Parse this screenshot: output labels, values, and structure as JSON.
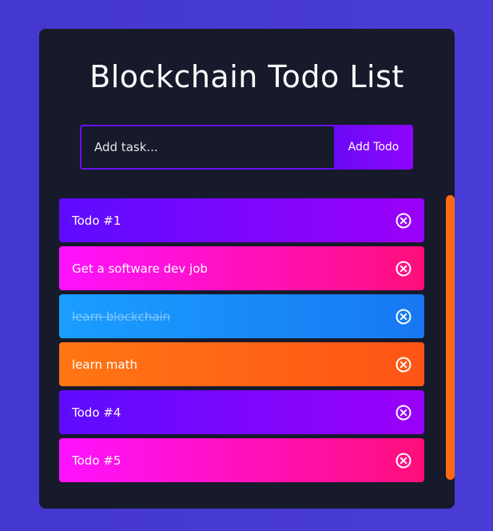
{
  "app": {
    "title": "Blockchain Todo List"
  },
  "form": {
    "input_placeholder": "Add task...",
    "input_value": "",
    "add_button_label": "Add Todo"
  },
  "todos": [
    {
      "text": "Todo #1",
      "color": "purple",
      "complete": false
    },
    {
      "text": "Get a software dev job",
      "color": "pink",
      "complete": false
    },
    {
      "text": "learn blockchain",
      "color": "blue",
      "complete": true
    },
    {
      "text": "learn math",
      "color": "orange",
      "complete": false
    },
    {
      "text": "Todo #4",
      "color": "purple",
      "complete": false
    },
    {
      "text": "Todo #5",
      "color": "pink",
      "complete": false
    }
  ],
  "icons": {
    "delete": "close-circle-icon"
  },
  "colors": {
    "background": "#4437cf",
    "panel": "#161a2b",
    "input_border": "#6a11f2",
    "purple": "#5d0cff",
    "pink": "#ff12ff",
    "blue": "#1a9eff",
    "orange": "#ff7614",
    "scrollbar": "#ff6a14"
  }
}
